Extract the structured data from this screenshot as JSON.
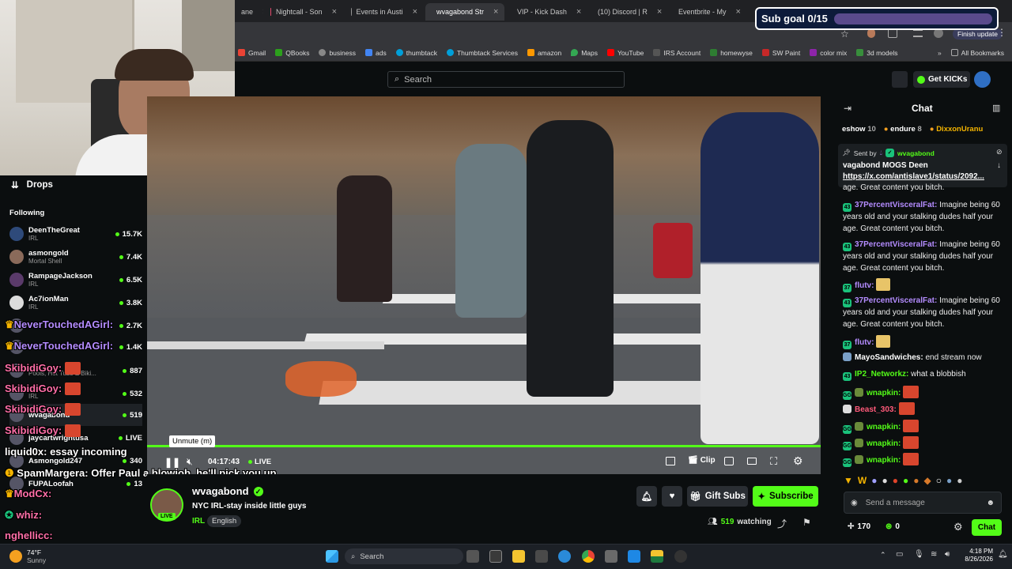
{
  "browser": {
    "tabs": [
      {
        "label": "ane",
        "color": "#888"
      },
      {
        "label": "Nightcall - Son",
        "color": "#e24a6d"
      },
      {
        "label": "Events in Austi",
        "color": "#999"
      },
      {
        "label": "wvagabond Str",
        "color": "#53fc18",
        "active": true
      },
      {
        "label": "VIP - Kick Dash",
        "color": "#53fc18"
      },
      {
        "label": "(10) Discord | R",
        "color": "#8c5ad8"
      },
      {
        "label": "Eventbrite - My",
        "color": "#f05537"
      }
    ],
    "finish_update": "Finish update",
    "bookmarks": [
      {
        "label": "Gmail",
        "color": "#ea4335"
      },
      {
        "label": "QBooks",
        "color": "#2ca01c"
      },
      {
        "label": "business",
        "color": "#888"
      },
      {
        "label": "ads",
        "color": "#4285f4"
      },
      {
        "label": "thumbtack",
        "color": "#009fd9"
      },
      {
        "label": "Thumbtack Services",
        "color": "#009fd9"
      },
      {
        "label": "amazon",
        "color": "#ff9900"
      },
      {
        "label": "Maps",
        "color": "#34a853"
      },
      {
        "label": "YouTube",
        "color": "#ff0000"
      },
      {
        "label": "IRS Account",
        "color": "#555"
      },
      {
        "label": "homewyse",
        "color": "#2e7d32"
      },
      {
        "label": "SW Paint",
        "color": "#c62828"
      },
      {
        "label": "color mix",
        "color": "#8e24aa"
      },
      {
        "label": "3d models",
        "color": "#388e3c"
      }
    ],
    "all_bookmarks": "All Bookmarks"
  },
  "subgoal": {
    "label": "Sub goal 0/15",
    "progress": 0.0
  },
  "header": {
    "search_placeholder": "Search",
    "get_kicks": "Get KICKs"
  },
  "sidebar": {
    "drops": "Drops",
    "following": "Following",
    "channels": [
      {
        "name": "DeenTheGreat",
        "category": "IRL",
        "viewers": "15.7K"
      },
      {
        "name": "asmongold",
        "category": "Mortal Shell",
        "viewers": "7.4K"
      },
      {
        "name": "RampageJackson",
        "category": "IRL",
        "viewers": "6.5K"
      },
      {
        "name": "Ac7ionMan",
        "category": "IRL",
        "viewers": "3.8K"
      },
      {
        "name": "",
        "category": "IRL",
        "viewers": "2.7K"
      },
      {
        "name": "",
        "category": "IRL",
        "viewers": "1.4K"
      },
      {
        "name": "",
        "category": "Pools, Hot Tubs & Biki...",
        "viewers": "887"
      },
      {
        "name": "",
        "category": "IRL",
        "viewers": "532"
      },
      {
        "name": "wvagabond",
        "category": "",
        "viewers": "519"
      },
      {
        "name": "jaycartwrightusa",
        "category": "",
        "viewers": "LIVE"
      },
      {
        "name": "Asmongold247",
        "category": "",
        "viewers": "340"
      },
      {
        "name": "FUPALoofah",
        "category": "",
        "viewers": "13"
      }
    ]
  },
  "overlay_chat": [
    {
      "user": "NeverTouchedAGirl:",
      "text": "",
      "color": "#b48cff"
    },
    {
      "user": "NeverTouchedAGirl:",
      "text": "",
      "color": "#b48cff"
    },
    {
      "user": "SkibidiGoy:",
      "text": "",
      "color": "#ff6fa8"
    },
    {
      "user": "SkibidiGoy:",
      "text": "",
      "color": "#ff6fa8"
    },
    {
      "user": "SkibidiGoy:",
      "text": "",
      "color": "#ff6fa8"
    },
    {
      "user": "SkibidiGoy:",
      "text": "",
      "color": "#ff6fa8"
    },
    {
      "user": "liquid0x:",
      "text": "essay incoming",
      "color": "#ffffff"
    },
    {
      "user": "SpamMargera:",
      "text": "Offer Paul a blowjob, he'll pick you up",
      "color": "#ffffff"
    },
    {
      "user": "ModCx:",
      "text": "",
      "color": "#ff6fa8"
    },
    {
      "user": "whiz:",
      "text": "",
      "color": "#ff6fa8"
    },
    {
      "user": "nghellicc:",
      "text": "",
      "color": "#ff6fa8"
    }
  ],
  "player": {
    "tooltip": "Unmute (m)",
    "time": "04:17:43",
    "live": "LIVE",
    "clip": "Clip"
  },
  "stream": {
    "streamer": "wvagabond",
    "live_badge": "LIVE",
    "title": "NYC IRL-stay inside little guys",
    "category": "IRL",
    "language": "English",
    "gift_subs": "Gift Subs",
    "subscribe": "Subscribe",
    "watching_count": "519",
    "watching_label": "watching"
  },
  "chat": {
    "title": "Chat",
    "top_gifters": [
      {
        "name": "eshow",
        "count": "10"
      },
      {
        "name": "endure",
        "count": "8"
      },
      {
        "name": "DixxonUranu",
        "count": ""
      }
    ],
    "pinned": {
      "sent_by": "Sent by",
      "author": "wvagabond",
      "text": "vagabond MOGS Deen",
      "link": "https://x.com/antislave1/status/2092..."
    },
    "messages": [
      {
        "user": "",
        "text": "age. Great content you bitch.",
        "color": "#ffffff"
      },
      {
        "user": "37PercentVisceralFat:",
        "text": "Imagine being 60 years old and your stalking dudes half your age. Great content you bitch.",
        "color": "#b48cff"
      },
      {
        "user": "37PercentVisceralFat:",
        "text": "Imagine being 60 years old and your stalking dudes half your age. Great content you bitch.",
        "color": "#b48cff"
      },
      {
        "user": "flutv:",
        "text": "",
        "color": "#b48cff"
      },
      {
        "user": "37PercentVisceralFat:",
        "text": "Imagine being 60 years old and your stalking dudes half your age. Great content you bitch.",
        "color": "#b48cff"
      },
      {
        "user": "flutv:",
        "text": "",
        "color": "#b48cff"
      },
      {
        "user": "MayoSandwiches:",
        "text": "end stream now",
        "color": "#ffffff"
      },
      {
        "user": "IP2_Networkz:",
        "text": "what a blobbish",
        "color": "#53fc18"
      },
      {
        "user": "wnapkin:",
        "text": "",
        "color": "#53fc18"
      },
      {
        "user": "Beast_303:",
        "text": "",
        "color": "#ff5a7a"
      },
      {
        "user": "wnapkin:",
        "text": "",
        "color": "#53fc18"
      },
      {
        "user": "wnapkin:",
        "text": "",
        "color": "#53fc18"
      },
      {
        "user": "wnapkin:",
        "text": "",
        "color": "#53fc18"
      }
    ],
    "input_placeholder": "Send a message",
    "points": "170",
    "kicks": "0",
    "chat_button": "Chat"
  },
  "taskbar": {
    "weather_temp": "74°F",
    "weather_desc": "Sunny",
    "search": "Search",
    "time": "4:18 PM",
    "date": "8/26/2026"
  },
  "colors": {
    "kick_green": "#53fc18",
    "bg": "#0b0e0f"
  }
}
